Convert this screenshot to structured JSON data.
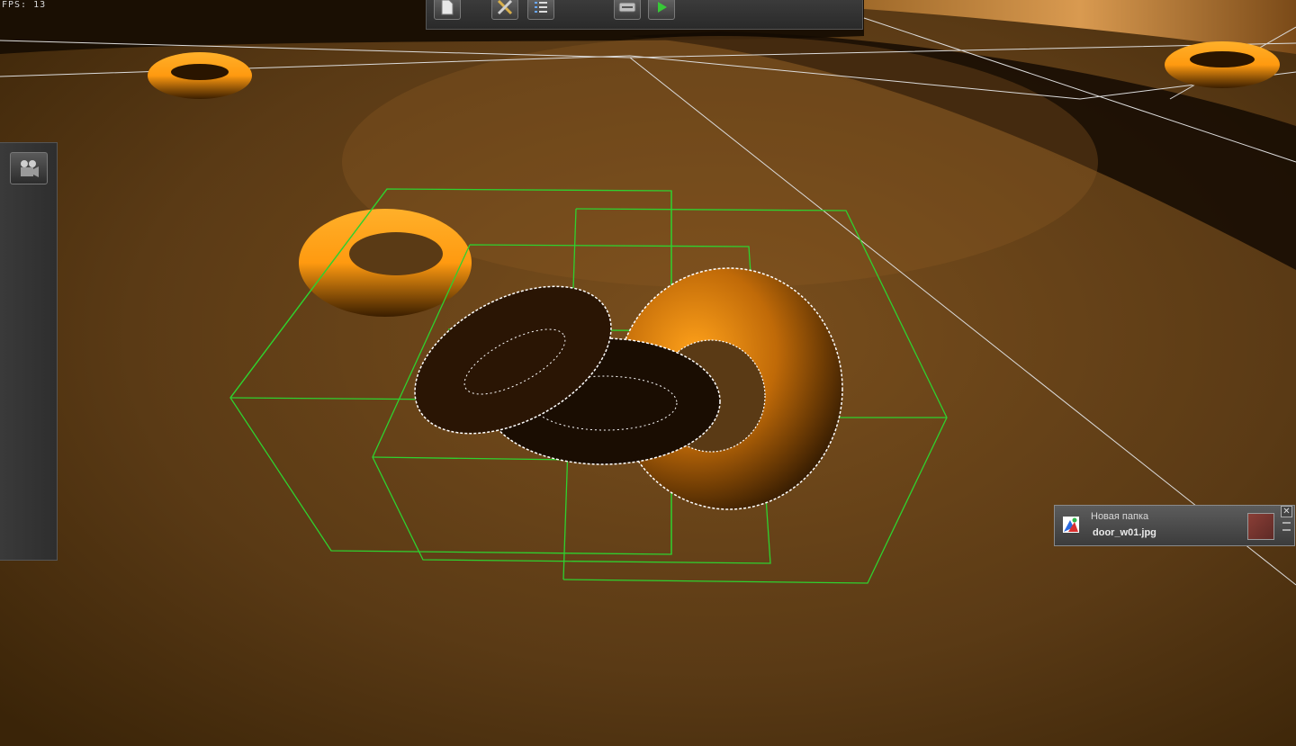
{
  "hud": {
    "fps_label": "FPS:",
    "fps_value": "13"
  },
  "toolbar": {
    "buttons": [
      {
        "name": "new-document",
        "icon": "document-icon"
      },
      {
        "name": "tools",
        "icon": "tools-icon"
      },
      {
        "name": "list",
        "icon": "list-icon"
      },
      {
        "name": "network",
        "icon": "network-icon"
      },
      {
        "name": "play",
        "icon": "play-icon"
      }
    ]
  },
  "sidepanel": {
    "camera_icon": "camera-icon"
  },
  "file_tooltip": {
    "folder": "Новая папка",
    "filename": "door_w01.jpg",
    "close_glyph": "✕"
  },
  "colors": {
    "floor": "#5a3a15",
    "torus": "#ff9a12",
    "bbox": "#2fd12f",
    "wire": "#ffffff",
    "panel": "#333333"
  }
}
